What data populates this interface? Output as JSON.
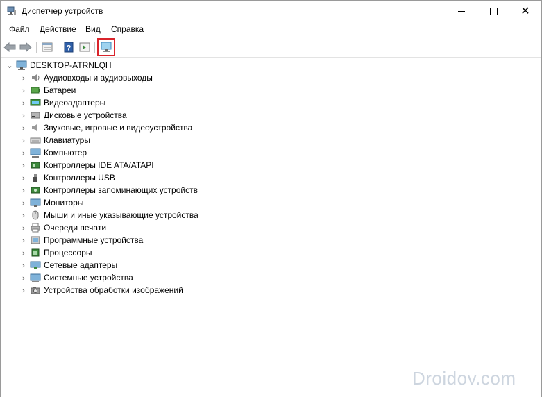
{
  "window": {
    "title": "Диспетчер устройств",
    "controls": {
      "minimize": "minimize-icon",
      "maximize": "maximize-icon",
      "close": "✕"
    }
  },
  "menu": {
    "items": [
      {
        "label": "Файл"
      },
      {
        "label": "Действие"
      },
      {
        "label": "Вид"
      },
      {
        "label": "Справка"
      }
    ]
  },
  "toolbar": {
    "buttons": [
      {
        "icon": "back-arrow-icon"
      },
      {
        "icon": "forward-arrow-icon"
      },
      {
        "icon": "properties-icon"
      },
      {
        "icon": "help-icon"
      },
      {
        "icon": "run-action-icon"
      },
      {
        "icon": "scan-hardware-icon",
        "highlighted": true
      }
    ],
    "highlight_color": "#d9242b"
  },
  "tree": {
    "root": {
      "label": "DESKTOP-ATRNLQH",
      "expanded": true
    },
    "categories": [
      {
        "label": "Аудиовходы и аудиовыходы",
        "icon": "audio-io-icon"
      },
      {
        "label": "Батареи",
        "icon": "battery-icon"
      },
      {
        "label": "Видеоадаптеры",
        "icon": "display-adapter-icon"
      },
      {
        "label": "Дисковые устройства",
        "icon": "disk-drive-icon"
      },
      {
        "label": "Звуковые, игровые и видеоустройства",
        "icon": "speaker-icon"
      },
      {
        "label": "Клавиатуры",
        "icon": "keyboard-icon"
      },
      {
        "label": "Компьютер",
        "icon": "computer-icon"
      },
      {
        "label": "Контроллеры IDE ATA/ATAPI",
        "icon": "ide-controller-icon"
      },
      {
        "label": "Контроллеры USB",
        "icon": "usb-icon"
      },
      {
        "label": "Контроллеры запоминающих устройств",
        "icon": "storage-controller-icon"
      },
      {
        "label": "Мониторы",
        "icon": "monitor-icon"
      },
      {
        "label": "Мыши и иные указывающие устройства",
        "icon": "mouse-icon"
      },
      {
        "label": "Очереди печати",
        "icon": "printer-icon"
      },
      {
        "label": "Программные устройства",
        "icon": "software-device-icon"
      },
      {
        "label": "Процессоры",
        "icon": "processor-icon"
      },
      {
        "label": "Сетевые адаптеры",
        "icon": "network-adapter-icon"
      },
      {
        "label": "Системные устройства",
        "icon": "system-device-icon"
      },
      {
        "label": "Устройства обработки изображений",
        "icon": "camera-icon"
      }
    ]
  },
  "watermark": "Droidov.com"
}
